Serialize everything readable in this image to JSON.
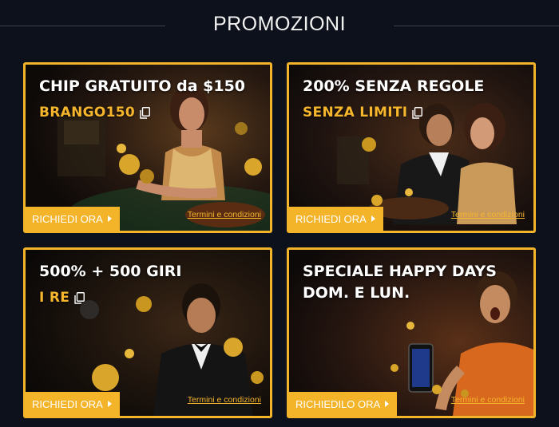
{
  "header": {
    "title": "PROMOZIONI"
  },
  "colors": {
    "accent": "#f4b42a",
    "background": "#0c111b"
  },
  "cards": [
    {
      "headline": "CHIP GRATUITO da $150",
      "headline_line2": "",
      "code": "BRANGO150",
      "claim_label": "RICHIEDI ORA",
      "terms_label": "Termini e condizioni",
      "image": "woman-in-gold-dress-at-roulette"
    },
    {
      "headline": "200% SENZA REGOLE",
      "headline_line2": "",
      "code": "SENZA LIMITI",
      "claim_label": "RICHIEDI ORA",
      "terms_label": "Termini e condizioni",
      "image": "couple-at-casino-table"
    },
    {
      "headline": "500% + 500 GIRI",
      "headline_line2": "",
      "code": "I RE",
      "claim_label": "RICHIEDI ORA",
      "terms_label": "Termini e condizioni",
      "image": "man-in-tuxedo-with-gold-coins"
    },
    {
      "headline": "SPECIALE HAPPY DAYS",
      "headline_line2": "DOM. E LUN.",
      "code": "",
      "claim_label": "RICHIEDILO ORA",
      "terms_label": "Termini e condizioni",
      "image": "excited-man-with-phone-and-coins"
    }
  ]
}
